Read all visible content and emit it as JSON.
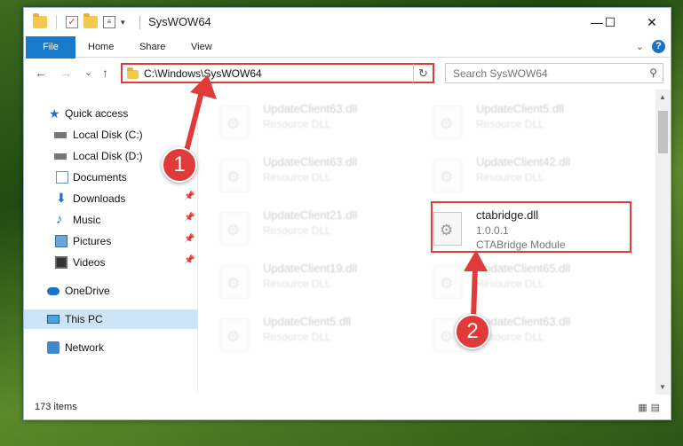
{
  "window": {
    "title": "SysWOW64",
    "controls": {
      "minimize": "—",
      "maximize": "☐",
      "close": "✕"
    }
  },
  "ribbon": {
    "tabs": [
      "File",
      "Home",
      "Share",
      "View"
    ]
  },
  "navigation": {
    "back": "←",
    "forward": "→",
    "recent": "⌄",
    "up": "↑",
    "address_path": "C:\\Windows\\SysWOW64",
    "search_placeholder": "Search SysWOW64"
  },
  "sidebar": {
    "items": [
      {
        "label": "Quick access",
        "icon": "star-icon",
        "pinned": false
      },
      {
        "label": "Local Disk (C:)",
        "icon": "drive-icon",
        "pinned": true
      },
      {
        "label": "Local Disk (D:)",
        "icon": "drive-icon",
        "pinned": true
      },
      {
        "label": "Documents",
        "icon": "documents-icon",
        "pinned": true
      },
      {
        "label": "Downloads",
        "icon": "downloads-icon",
        "pinned": true
      },
      {
        "label": "Music",
        "icon": "music-icon",
        "pinned": true
      },
      {
        "label": "Pictures",
        "icon": "pictures-icon",
        "pinned": true
      },
      {
        "label": "Videos",
        "icon": "videos-icon",
        "pinned": true
      },
      {
        "label": "OneDrive",
        "icon": "cloud-icon",
        "pinned": false
      },
      {
        "label": "This PC",
        "icon": "computer-icon",
        "pinned": false,
        "selected": true
      },
      {
        "label": "Network",
        "icon": "network-icon",
        "pinned": false
      }
    ]
  },
  "files": [
    {
      "name": "UpdateClient63.dll",
      "line2": "Resource DLL",
      "faded": true
    },
    {
      "name": "UpdateClient5.dll",
      "line2": "Resource DLL",
      "faded": true
    },
    {
      "name": "UpdateClient63.dll",
      "line2": "Resource DLL",
      "faded": true
    },
    {
      "name": "UpdateClient42.dll",
      "line2": "Resource DLL",
      "faded": true
    },
    {
      "name": "UpdateClient21.dll",
      "line2": "Resource DLL",
      "faded": true
    },
    {
      "name": "ctabridge.dll",
      "line2": "1.0.0.1",
      "line3": "CTABridge Module",
      "faded": false
    },
    {
      "name": "UpdateClient19.dll",
      "line2": "Resource DLL",
      "faded": true
    },
    {
      "name": "UpdateClient65.dll",
      "line2": "Resource DLL",
      "faded": true
    },
    {
      "name": "UpdateClient5.dll",
      "line2": "Resource DLL",
      "faded": true
    },
    {
      "name": "UpdateClient63.dll",
      "line2": "Resource DLL",
      "faded": true
    }
  ],
  "status": {
    "item_count": "173 items"
  },
  "annotations": {
    "step1": "1",
    "step2": "2",
    "color": "#e03a3a"
  }
}
